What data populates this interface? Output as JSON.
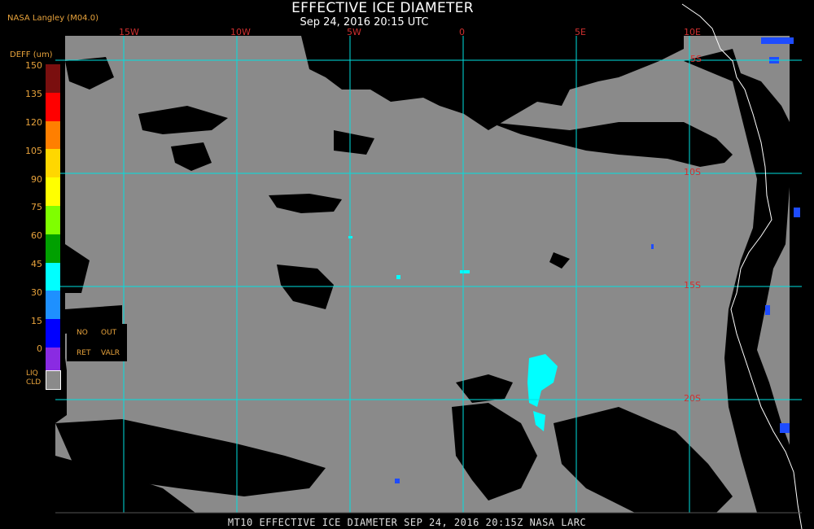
{
  "header": {
    "title": "EFFECTIVE ICE DIAMETER",
    "subtitle": "Sep 24, 2016 20:15 UTC",
    "agency": "NASA Langley (M04.0)"
  },
  "grid": {
    "lon_labels": [
      "15W",
      "10W",
      "5W",
      "0",
      "5E",
      "10E"
    ],
    "lat_labels": [
      "5S",
      "10S",
      "15S",
      "20S"
    ]
  },
  "legend": {
    "title": "DEFF (um)",
    "ticks": [
      "150",
      "135",
      "120",
      "105",
      "90",
      "75",
      "60",
      "45",
      "30",
      "15",
      "0"
    ],
    "colors": [
      "#7a0f0f",
      "#ff0000",
      "#ff7f00",
      "#ffd700",
      "#ffff00",
      "#7fff00",
      "#00a000",
      "#00ffff",
      "#1e90ff",
      "#0000ff",
      "#8a2be2"
    ],
    "no_ret": "NO",
    "no_ret2": "RET",
    "out_valr": "OUT",
    "out_valr2": "VALR",
    "liq_cld": "LIQ",
    "liq_cld2": "CLD"
  },
  "colors": {
    "no_data": "#000000",
    "liquid_cloud": "#8a8a8a",
    "grid_line": "#00e0e0",
    "coast_line": "#ffffff"
  },
  "footer": "MT10  EFFECTIVE ICE DIAMETER  SEP 24, 2016 20:15Z  NASA LARC"
}
